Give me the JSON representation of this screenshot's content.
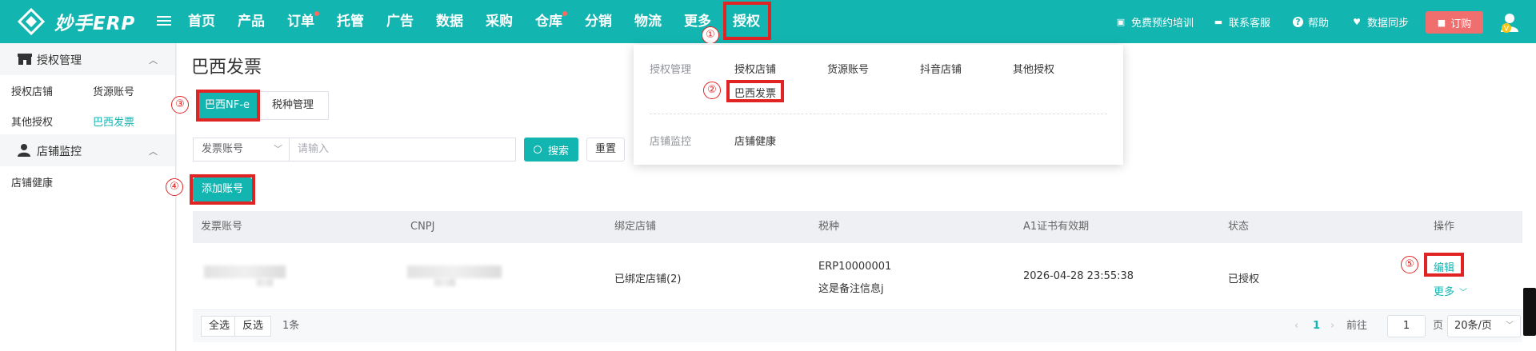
{
  "app": {
    "logo_text": "妙手ERP"
  },
  "nav": [
    {
      "label": "首页",
      "dot": false
    },
    {
      "label": "产品",
      "dot": false
    },
    {
      "label": "订单",
      "dot": true
    },
    {
      "label": "托管",
      "dot": false
    },
    {
      "label": "广告",
      "dot": false
    },
    {
      "label": "数据",
      "dot": false
    },
    {
      "label": "采购",
      "dot": false
    },
    {
      "label": "仓库",
      "dot": true
    },
    {
      "label": "分销",
      "dot": false
    },
    {
      "label": "物流",
      "dot": false
    },
    {
      "label": "更多",
      "dot": false
    },
    {
      "label": "授权",
      "dot": false
    }
  ],
  "header_right": {
    "training": "免费预约培训",
    "support": "联系客服",
    "help": "帮助",
    "sync": "数据同步",
    "order": "订购",
    "avatar_badge": "V"
  },
  "steps": [
    "①",
    "②",
    "③",
    "④",
    "⑤"
  ],
  "dropdown": {
    "group1_label": "授权管理",
    "group1_items": [
      "授权店铺",
      "货源账号",
      "抖音店铺",
      "其他授权",
      "巴西发票"
    ],
    "group2_label": "店铺监控",
    "group2_items": [
      "店铺健康"
    ]
  },
  "sidebar": {
    "group1": {
      "label": "授权管理",
      "items": [
        "授权店铺",
        "货源账号",
        "其他授权",
        "巴西发票"
      ]
    },
    "group2": {
      "label": "店铺监控",
      "items": [
        "店铺健康"
      ]
    }
  },
  "page": {
    "title": "巴西发票",
    "tabs": [
      "巴西NF-e",
      "税种管理"
    ],
    "filter": {
      "select_value": "发票账号",
      "placeholder": "请输入",
      "search": "搜索",
      "reset": "重置"
    },
    "add_button": "添加账号"
  },
  "table": {
    "columns": [
      "发票账号",
      "CNPJ",
      "绑定店铺",
      "税种",
      "A1证书有效期",
      "状态",
      "操作"
    ],
    "rows": [
      {
        "bound_store": "已绑定店铺(2)",
        "tax_code": "ERP10000001",
        "tax_note": "这是备注信息j",
        "cert_expiry": "2026-04-28 23:55:38",
        "status": "已授权",
        "edit": "编辑",
        "more": "更多"
      }
    ]
  },
  "footer": {
    "select_all": "全选",
    "invert": "反选",
    "count": "1条",
    "current_page": "1",
    "goto_label": "前往",
    "goto_value": "1",
    "page_label": "页",
    "page_size": "20条/页"
  },
  "colors": {
    "primary": "#13b5b1",
    "highlight": "#e02424",
    "order_button": "#f06e6e"
  }
}
